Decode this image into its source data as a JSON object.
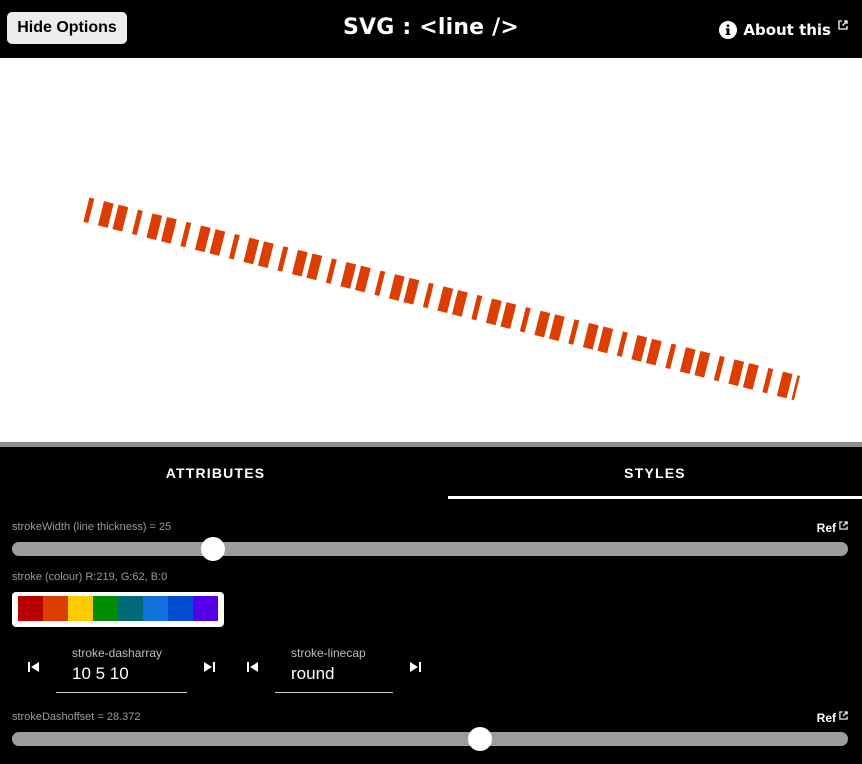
{
  "header": {
    "hide_button": "Hide Options",
    "title": "SVG : <line />",
    "about": "About this"
  },
  "canvas": {
    "stroke_color": "#DB3E00",
    "stroke_width": 25,
    "stroke_dasharray": "10 5 10",
    "stroke_linecap": "round",
    "stroke_dashoffset": 28.372
  },
  "tabs": [
    {
      "label": "ATTRIBUTES",
      "active": false
    },
    {
      "label": "STYLES",
      "active": true
    }
  ],
  "styles": {
    "stroke_width": {
      "label": "strokeWidth (line thickness) = 25",
      "ref": "Ref",
      "value": 25,
      "fraction": 0.24
    },
    "stroke": {
      "label": "stroke (colour) R:219, G:62, B:0",
      "swatches": [
        "#B80000",
        "#DB3E00",
        "#FCCB00",
        "#008B02",
        "#006B76",
        "#1273DE",
        "#004DCF",
        "#5300EB"
      ]
    },
    "dasharray": {
      "label": "stroke-dasharray",
      "value": "10 5 10"
    },
    "linecap": {
      "label": "stroke-linecap",
      "value": "round"
    },
    "dashoffset": {
      "label": "strokeDashoffset = 28.372",
      "ref": "Ref",
      "value": 28.372,
      "fraction": 0.56
    }
  },
  "colors": {
    "background": "#000000",
    "canvas": "#FFFFFF",
    "track": "#9D9D9D",
    "divider": "#8E8E8E"
  }
}
